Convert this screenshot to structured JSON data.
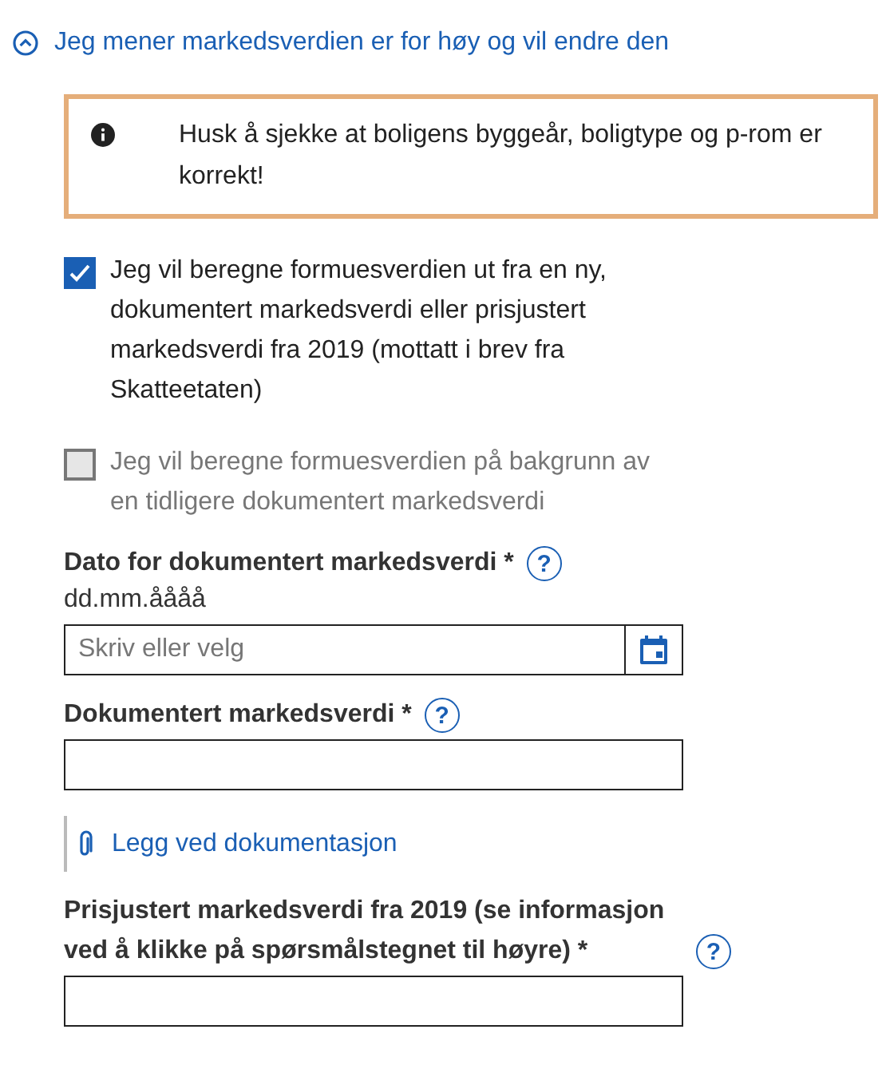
{
  "disclosure": {
    "label": "Jeg mener markedsverdien er for høy og vil endre den",
    "expanded": true
  },
  "alert": {
    "text": "Husk å sjekke at boligens byggeår, boligtype og p-rom er korrekt!"
  },
  "checkboxes": [
    {
      "label": "Jeg vil beregne formuesverdien ut fra en ny, dokumentert markedsverdi eller prisjustert markedsverdi fra 2019 (mottatt i brev fra Skatteetaten)",
      "checked": true,
      "disabled": false
    },
    {
      "label": "Jeg vil beregne formuesverdien på bakgrunn av en tidligere dokumentert markedsverdi",
      "checked": false,
      "disabled": true
    }
  ],
  "fields": [
    {
      "kind": "date",
      "label": "Dato for dokumentert markedsverdi",
      "required": "*",
      "help": "?",
      "hint": "dd.mm.åååå",
      "placeholder": "Skriv eller velg"
    },
    {
      "kind": "text",
      "label": "Dokumentert markedsverdi",
      "required": "*",
      "help": "?"
    },
    {
      "kind": "attachment",
      "label": "Legg ved dokumentasjon"
    },
    {
      "kind": "text",
      "label": "Prisjustert markedsverdi fra 2019 (se informasjon ved å klikke på spørsmålstegnet til høyre)",
      "required": "*",
      "help": "?"
    }
  ]
}
